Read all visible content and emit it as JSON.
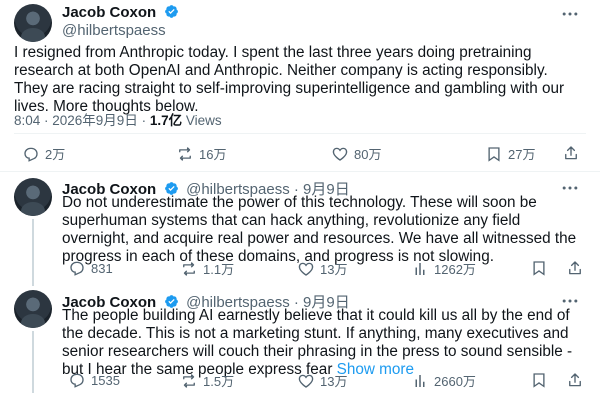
{
  "main_post": {
    "author_name": "Jacob Coxon",
    "author_handle": "@hilbertspaess",
    "text": "I resigned from Anthropic today. I spent the last three years doing pretraining research at both OpenAI and Anthropic. Neither company is acting responsibly. They are racing straight to self-improving superintelligence and gambling with our lives. More thoughts below.",
    "lines": [
      "I resigned from Anthropic today. I spent the last three years doing pretraining",
      "research at both OpenAI and Anthropic. Neither company is acting responsibly.",
      "They are racing straight to self-improving superintelligence and gambling with our",
      "lives. More thoughts below."
    ],
    "time": "8:04 · 2026年9月9日 · ",
    "views_count": "1.7亿",
    "views_label": " Views",
    "replies": "2万",
    "reposts": "16万",
    "likes": "80万",
    "bookmarks": "27万"
  },
  "replies": [
    {
      "author_name": "Jacob Coxon",
      "author_handle": "@hilbertspaess",
      "date": " · 9月9日",
      "lines": [
        "Do not underestimate the power of this technology. These will soon be",
        "superhuman systems that can hack anything, revolutionize any field",
        "overnight, and acquire real power and resources. We have all witnessed the",
        "progress in each of these domains, and progress is not slowing."
      ],
      "replies": "831",
      "reposts": "1.1万",
      "likes": "13万",
      "views": "1262万"
    },
    {
      "author_name": "Jacob Coxon",
      "author_handle": "@hilbertspaess",
      "date": " · 9月9日",
      "lines": [
        "The people building AI earnestly believe that it could kill us all by the end of",
        "the decade. This is not a marketing stunt. If anything, many executives and",
        "senior researchers will couch their phrasing in the press to sound sensible -",
        "but I hear the same people express fear "
      ],
      "show_more": "Show more",
      "replies": "1535",
      "reposts": "1.5万",
      "likes": "13万",
      "views": "2660万"
    }
  ],
  "colors": {
    "text": "#0f1419",
    "muted": "#536471",
    "accent": "#1d9bf0",
    "divider": "#eff3f4"
  },
  "icons": [
    "verified-badge-icon",
    "more-icon",
    "reply-icon",
    "repost-icon",
    "like-icon",
    "views-icon",
    "bookmark-icon",
    "share-icon"
  ]
}
